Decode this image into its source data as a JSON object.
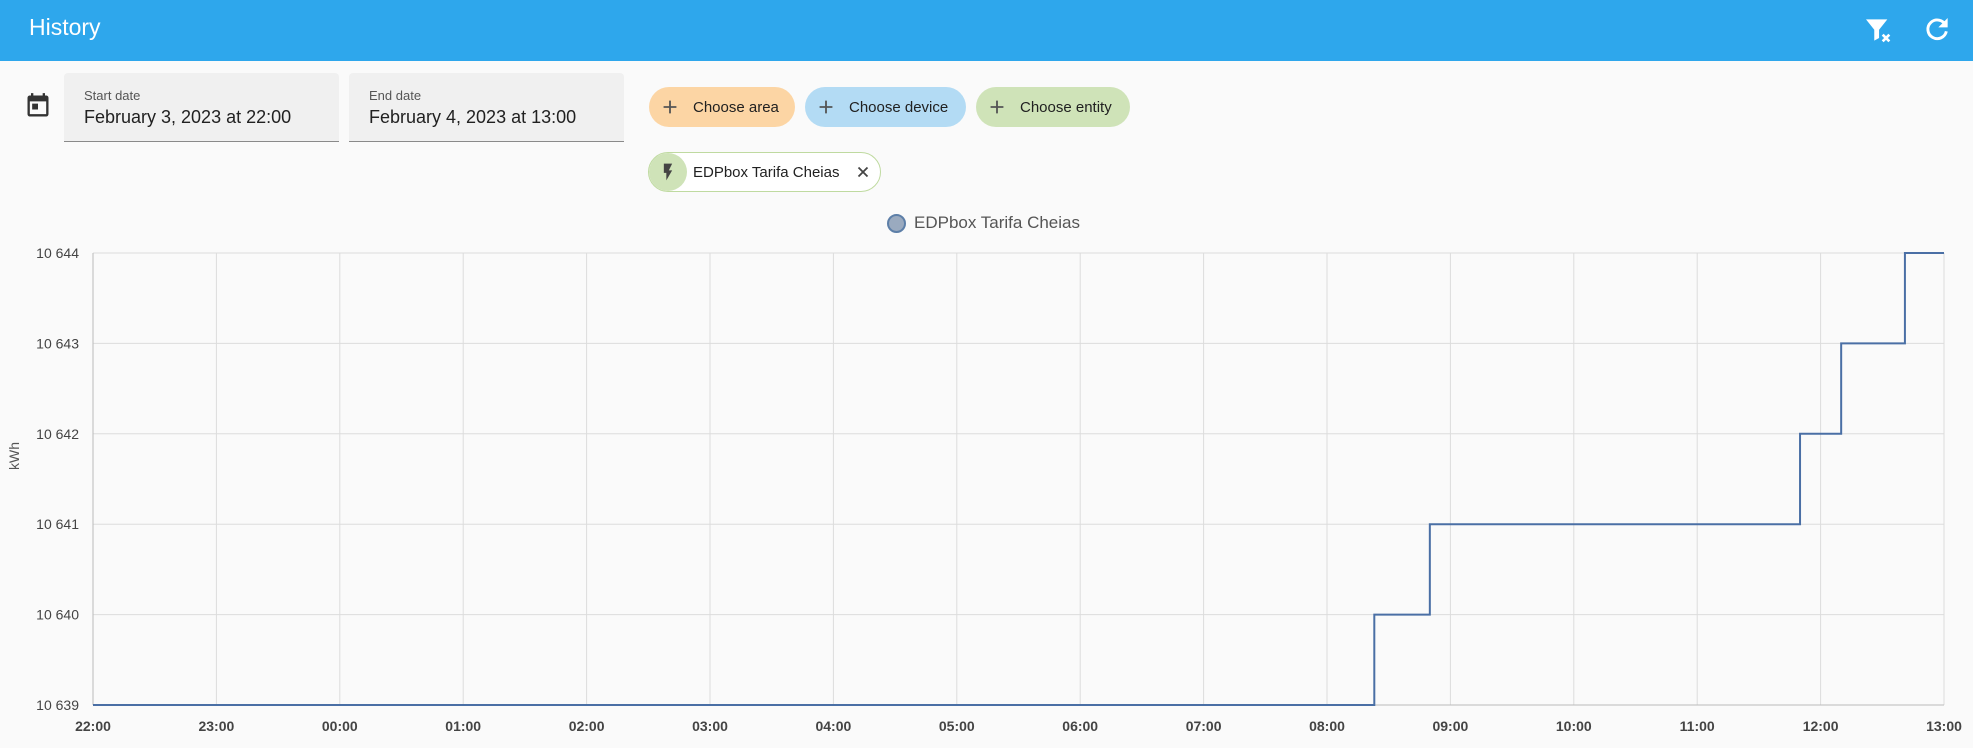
{
  "header": {
    "title": "History",
    "clear_filter_icon": "filter-remove-icon",
    "refresh_icon": "refresh-icon"
  },
  "date_range": {
    "icon": "calendar-icon",
    "start_label": "Start date",
    "start_value": "February 3, 2023 at 22:00",
    "end_label": "End date",
    "end_value": "February 4, 2023 at 13:00"
  },
  "targets": {
    "choose_area": "Choose area",
    "choose_device": "Choose device",
    "choose_entity": "Choose entity",
    "area_color": "#fcd5a4",
    "device_color": "#b3dbf4",
    "entity_color": "#cfe3b8",
    "selected": [
      {
        "name": "EDPbox Tarifa Cheias",
        "icon": "flash-icon"
      }
    ]
  },
  "chart_data": {
    "type": "line",
    "step": true,
    "title": "",
    "ylabel": "kWh",
    "xlabel": "",
    "legend": "top-center",
    "grid": true,
    "series_color": "#4a6fa5",
    "x_ticks": [
      "22:00",
      "23:00",
      "00:00",
      "01:00",
      "02:00",
      "03:00",
      "04:00",
      "05:00",
      "06:00",
      "07:00",
      "08:00",
      "09:00",
      "10:00",
      "11:00",
      "12:00",
      "13:00"
    ],
    "y_ticks": [
      "10 639",
      "10 640",
      "10 641",
      "10 642",
      "10 643",
      "10 644"
    ],
    "ylim": [
      10639,
      10644
    ],
    "x_range_hours": [
      0,
      15
    ],
    "series": [
      {
        "name": "EDPbox Tarifa Cheias",
        "points": [
          {
            "t": "22:00",
            "y": 10639
          },
          {
            "t": "08:23",
            "y": 10640
          },
          {
            "t": "08:50",
            "y": 10641
          },
          {
            "t": "11:50",
            "y": 10642
          },
          {
            "t": "12:10",
            "y": 10643
          },
          {
            "t": "12:41",
            "y": 10644
          },
          {
            "t": "13:00",
            "y": 10644
          }
        ]
      }
    ]
  }
}
